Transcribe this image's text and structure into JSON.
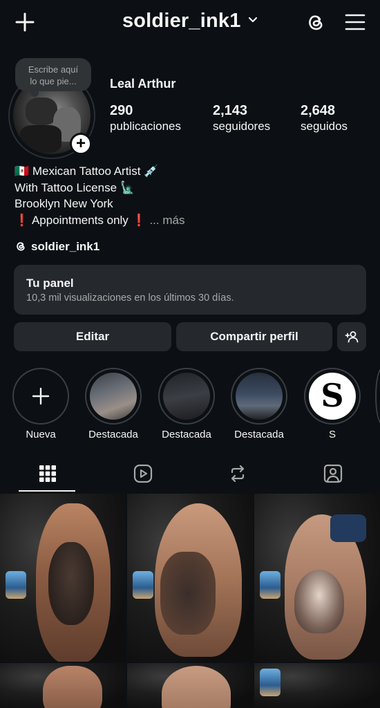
{
  "header": {
    "username": "soldier_ink1",
    "icons": [
      "plus-icon",
      "chevron-down-icon",
      "threads-icon",
      "menu-icon"
    ]
  },
  "note": {
    "line1": "Escribe aquí",
    "line2": "lo que pie..."
  },
  "profile": {
    "name": "Leal Arthur",
    "stats": [
      {
        "value": "290",
        "label": "publicaciones"
      },
      {
        "value": "2,143",
        "label": "seguidores"
      },
      {
        "value": "2,648",
        "label": "seguidos"
      }
    ],
    "bio": [
      "🇲🇽 Mexican Tattoo Artist 💉",
      "With Tattoo License 🗽",
      "Brooklyn New York",
      "❗ Appointments only ❗"
    ],
    "bio_more": "... más",
    "threads_handle": "soldier_ink1"
  },
  "panel": {
    "title": "Tu panel",
    "subtitle": "10,3 mil visualizaciones en los últimos 30 días."
  },
  "buttons": {
    "edit": "Editar",
    "share": "Compartir perfil"
  },
  "highlights": [
    {
      "label": "Nueva"
    },
    {
      "label": "Destacada"
    },
    {
      "label": "Destacada"
    },
    {
      "label": "Destacada"
    },
    {
      "label": "S"
    }
  ],
  "tabs": [
    "grid-icon",
    "reels-icon",
    "reposts-icon",
    "tagged-icon"
  ],
  "colors": {
    "background": "#0c1014",
    "surface": "#25292e",
    "text": "#f5f5f5",
    "muted": "#a8a8a8"
  }
}
